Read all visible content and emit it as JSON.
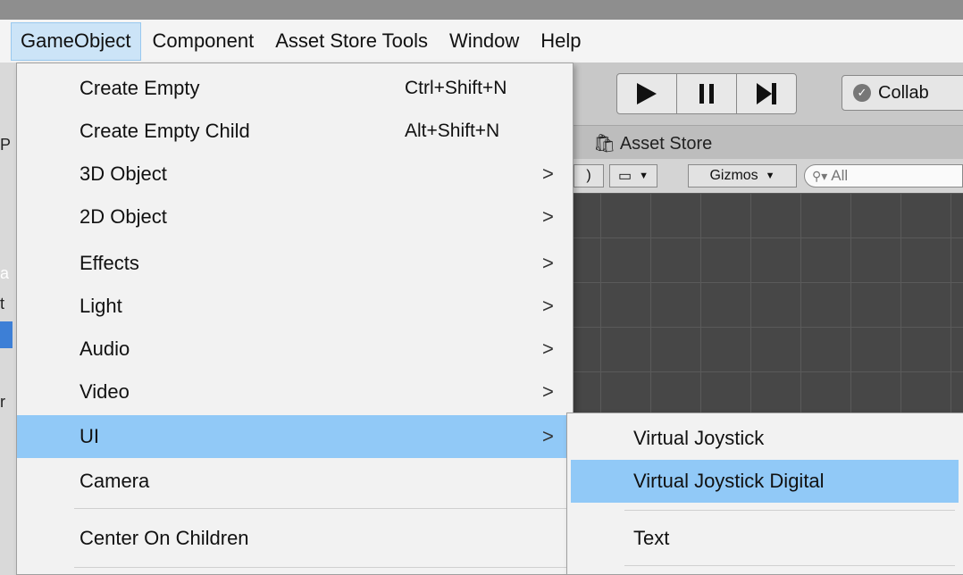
{
  "menubar": {
    "items": [
      "GameObject",
      "Component",
      "Asset Store Tools",
      "Window",
      "Help"
    ],
    "active_index": 0
  },
  "toolbar": {
    "play_icons": [
      "play-icon",
      "pause-icon",
      "step-icon"
    ],
    "collab_label": "Collab"
  },
  "tabs": {
    "asset_store_label": "Asset Store"
  },
  "scene_toolbar": {
    "gizmos_label": "Gizmos",
    "search_placeholder": "All"
  },
  "gameobject_menu": {
    "items": [
      {
        "label": "Create Empty",
        "shortcut": "Ctrl+Shift+N"
      },
      {
        "label": "Create Empty Child",
        "shortcut": "Alt+Shift+N"
      },
      {
        "label": "3D Object",
        "submenu": true
      },
      {
        "label": "2D Object",
        "submenu": true
      },
      {
        "label": "Effects",
        "submenu": true
      },
      {
        "label": "Light",
        "submenu": true
      },
      {
        "label": "Audio",
        "submenu": true
      },
      {
        "label": "Video",
        "submenu": true
      },
      {
        "label": "UI",
        "submenu": true,
        "highlighted": true
      },
      {
        "label": "Camera"
      },
      {
        "label": "Center On Children"
      }
    ]
  },
  "ui_submenu": {
    "items": [
      {
        "label": "Virtual Joystick"
      },
      {
        "label": "Virtual Joystick Digital",
        "highlighted": true
      },
      {
        "label": "Text"
      }
    ]
  },
  "left_fragments": [
    "P",
    "a",
    "t",
    "r"
  ],
  "colors": {
    "highlight": "#91c9f7",
    "menu_bg": "#f2f2f2",
    "scene_bg": "#474747",
    "menubar_active": "#cce4f7"
  }
}
